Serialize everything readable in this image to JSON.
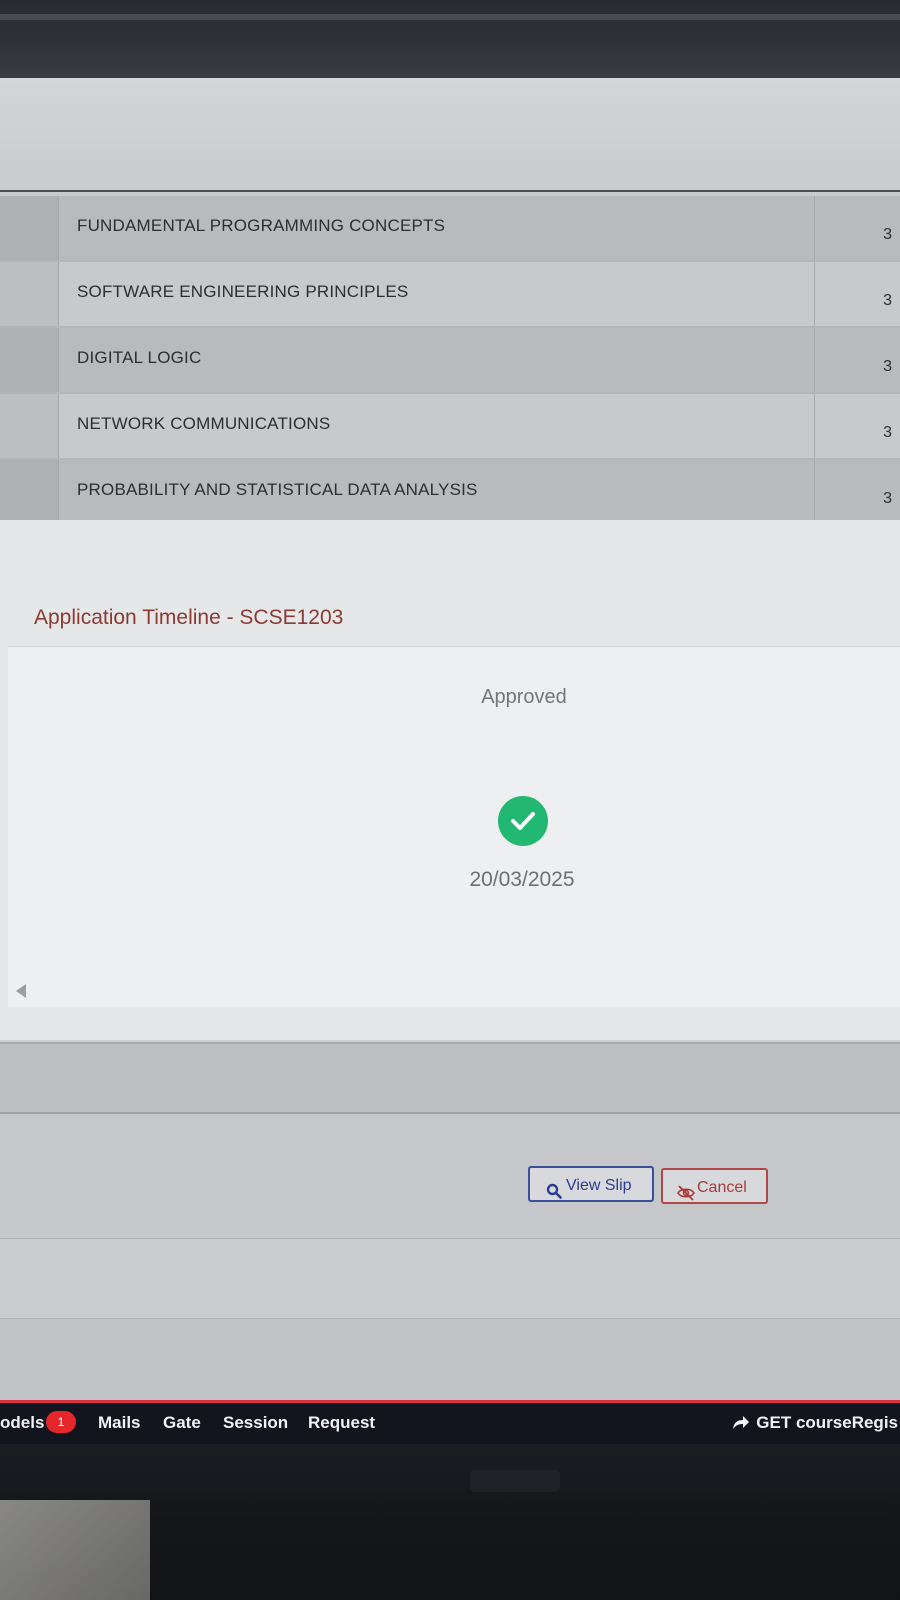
{
  "courses": [
    {
      "name": "FUNDAMENTAL PROGRAMMING CONCEPTS",
      "credits": "3"
    },
    {
      "name": "SOFTWARE ENGINEERING PRINCIPLES",
      "credits": "3"
    },
    {
      "name": "DIGITAL LOGIC",
      "credits": "3"
    },
    {
      "name": "NETWORK COMMUNICATIONS",
      "credits": "3"
    },
    {
      "name": "PROBABILITY AND STATISTICAL DATA ANALYSIS",
      "credits": "3"
    }
  ],
  "timeline": {
    "title": "Application Timeline - SCSE1203",
    "status": "Approved",
    "status_icon": "check-circle-icon",
    "status_color": "#22b871",
    "date": "20/03/2025"
  },
  "actions": {
    "view_slip_label": "View Slip",
    "cancel_label": "Cancel"
  },
  "taskbar": {
    "items": [
      {
        "label": "odels",
        "badge": "1"
      },
      {
        "label": "Mails"
      },
      {
        "label": "Gate"
      },
      {
        "label": "Session"
      },
      {
        "label": "Request"
      }
    ],
    "right_label": "GET courseRegis"
  },
  "colors": {
    "accent_red": "#d8333a",
    "view_button": "#2b3c8f",
    "cancel_button": "#a83a3a"
  }
}
